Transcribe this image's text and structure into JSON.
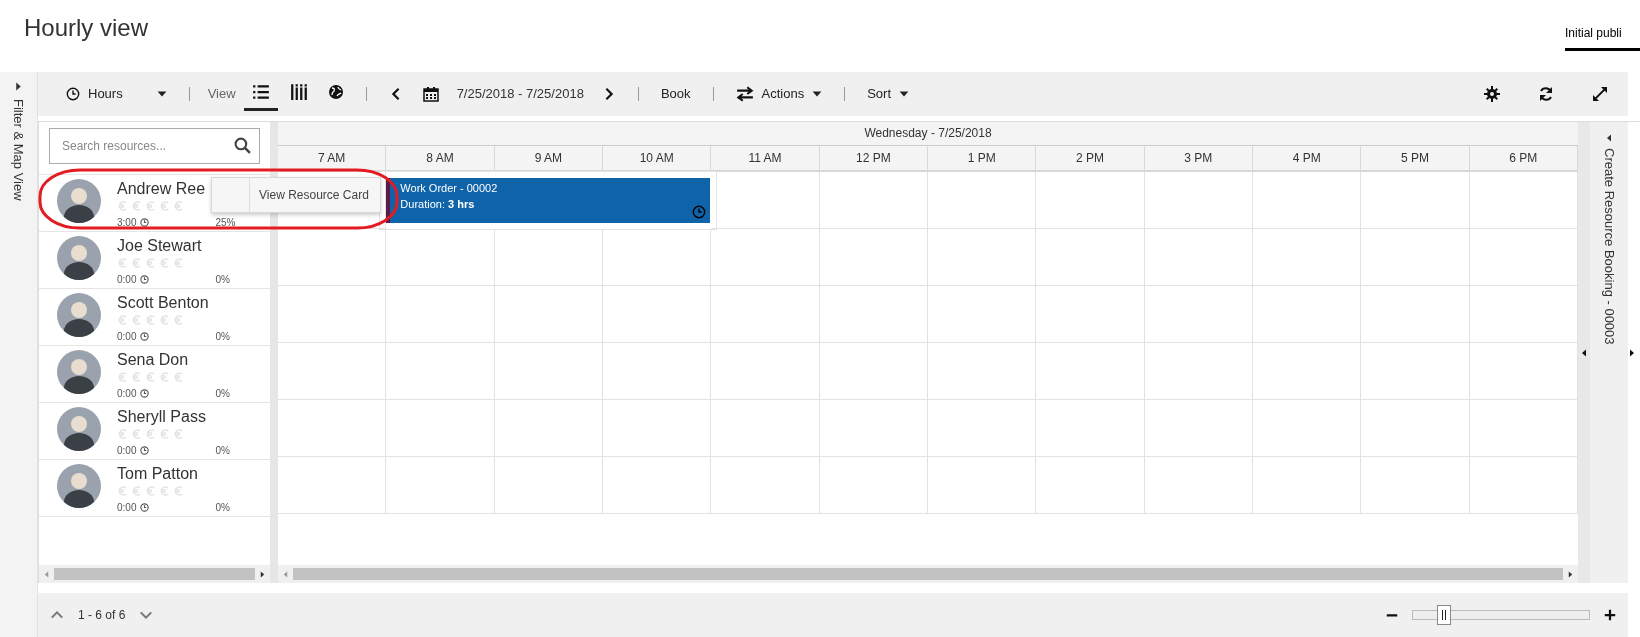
{
  "title": "Hourly view",
  "header_tabs": [
    {
      "label": "Initial publi",
      "selected": true
    }
  ],
  "left_rail": {
    "label": "Filter & Map View"
  },
  "toolbar": {
    "period": "Hours",
    "view_label": "View",
    "views": [
      {
        "kind": "list",
        "selected": true
      },
      {
        "kind": "columns",
        "selected": false
      },
      {
        "kind": "map",
        "selected": false
      }
    ],
    "date_range": "7/25/2018 - 7/25/2018",
    "book": "Book",
    "actions": "Actions",
    "sort": "Sort"
  },
  "search": {
    "placeholder": "Search resources..."
  },
  "resources": [
    {
      "name": "Andrew Ree",
      "stars": 0,
      "hours": "3:00",
      "utilization": "25%",
      "bookings": [
        {
          "title": "Work Order - 00002",
          "duration": "Duration: **3 hrs**"
        }
      ]
    },
    {
      "name": "Joe Stewart",
      "stars": 0,
      "hours": "0:00",
      "utilization": "0%"
    },
    {
      "name": "Scott Benton",
      "stars": 0,
      "hours": "0:00",
      "utilization": "0%"
    },
    {
      "name": "Sena Don",
      "stars": 0,
      "hours": "0:00",
      "utilization": "0%"
    },
    {
      "name": "Sheryll Pass",
      "stars": 0,
      "hours": "0:00",
      "utilization": "0%"
    },
    {
      "name": "Tom Patton",
      "stars": 0,
      "hours": "0:00",
      "utilization": "0%"
    }
  ],
  "context_menu": {
    "item": "View Resource Card"
  },
  "highlight_annotation": true,
  "schedule": {
    "day": "Wednesday - 7/25/2018",
    "hours": [
      "7 AM",
      "8 AM",
      "9 AM",
      "10 AM",
      "11 AM",
      "12 PM",
      "1 PM",
      "2 PM",
      "3 PM",
      "4 PM",
      "5 PM",
      "6 PM"
    ]
  },
  "right_panel": {
    "label": "Create Resource Booking - 00003"
  },
  "footer": {
    "range": "1 - 6 of 6",
    "zoom": {
      "level": 0.18
    }
  }
}
